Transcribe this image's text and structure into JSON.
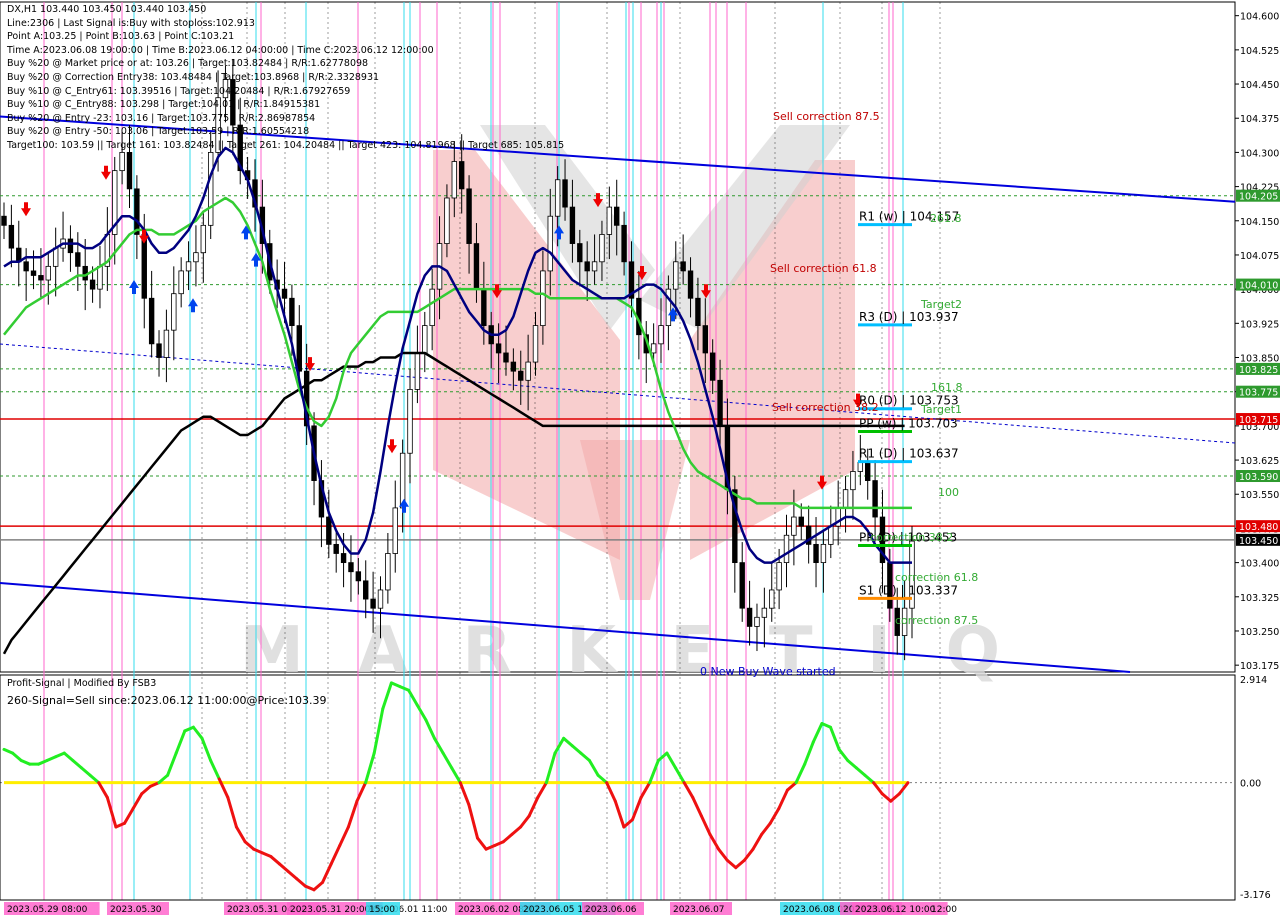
{
  "header": {
    "symbol_line": "DX,H1  103.440 103.450 103.440 103.450",
    "lines": [
      "Line:2306 | Last Signal is:Buy with stoploss:102.913",
      "Point A:103.25 | Point B:103.63 | Point C:103.21",
      "Time A:2023.06.08 19:00:00 | Time B:2023.06.12 04:00:00 | Time C:2023.06.12 12:00:00",
      "Buy %20 @ Market price or at: 103.26 | Target:103.82484 | R/R:1.62778098",
      "Buy %20 @ Correction Entry38: 103.48484 | Target:103.8968 | R/R:2.3328931",
      "Buy %10 @ C_Entry61: 103.39516 | Target:104.20484 | R/R:1.67927659",
      "Buy %10 @ C_Entry88: 103.298 | Target:104.01 | R/R:1.84915381",
      "Buy %20 @ Entry -23: 103.16 | Target:103.775 | R/R:2.86987854",
      "Buy %20 @ Entry -50: 103.06 | Target:103.59 | R/R:1.60554218",
      "Target100: 103.59 || Target 161: 103.82484 || Target 261: 104.20484 || Target 423: 104.81968 || Target 685: 105.815"
    ]
  },
  "indicator": {
    "title": "Profit-Signal | Modified By FSB3",
    "signal": "260-Signal=Sell since:2023.06.12 11:00:00@Price:103.39",
    "scale": [
      "2.914",
      "0.00",
      "-3.176"
    ]
  },
  "levels": [
    {
      "label": "R1 (w) | 104.157",
      "price": 104.157,
      "color": "#00bfff"
    },
    {
      "label": "R3 (D) | 103.937",
      "price": 103.937,
      "color": "#00bfff"
    },
    {
      "label": "R0 (D) | 103.753",
      "price": 103.753,
      "color": "#00bfff"
    },
    {
      "label": "PP (w) | 103.703",
      "price": 103.703,
      "color": "#00c000"
    },
    {
      "label": "R1 (D) | 103.637",
      "price": 103.637,
      "color": "#00bfff"
    },
    {
      "label": "PP (D) | 103.453",
      "price": 103.453,
      "color": "#00c000"
    },
    {
      "label": "S1 (D) | 103.337",
      "price": 103.337,
      "color": "#ff8c00"
    }
  ],
  "annotations": [
    {
      "text": "Sell correction 87.5",
      "color": "#c00000"
    },
    {
      "text": "Sell correction 61.8",
      "color": "#c00000"
    },
    {
      "text": "Sell correction 38.2",
      "color": "#c00000"
    },
    {
      "text": "261.8",
      "color": "#33aa33"
    },
    {
      "text": "Target2",
      "color": "#33aa33"
    },
    {
      "text": "161.8",
      "color": "#33aa33"
    },
    {
      "text": "Target1",
      "color": "#33aa33"
    },
    {
      "text": "100",
      "color": "#33aa33"
    },
    {
      "text": "correction 38.2",
      "color": "#33aa33"
    },
    {
      "text": "correction 61.8",
      "color": "#33aa33"
    },
    {
      "text": "correction 87.5",
      "color": "#33aa33"
    },
    {
      "text": "0 New Buy Wave started",
      "color": "#0000cc"
    }
  ],
  "time_labels": [
    "2023.05.29 08:00",
    "2023.05.30",
    "2023.05.31 04:00",
    "2023.05.31 20:00",
    "2023.06.01 11:00",
    "15:00",
    "2023.06.02 08:00",
    "2023.06.05 15:00",
    "2023.06.06",
    "2023.06.07",
    "2023.06.08 08:00",
    "2023.06.09",
    "2023.06.12 10:00",
    "12:00"
  ],
  "watermark": "MARKETIQ",
  "chart_data": {
    "type": "line",
    "price_axis": {
      "ticks": [
        "104.600",
        "104.525",
        "104.450",
        "104.375",
        "104.300",
        "104.225",
        "104.150",
        "104.075",
        "104.000",
        "103.925",
        "103.850",
        "103.775",
        "103.700",
        "103.625",
        "103.550",
        "103.475",
        "103.400",
        "103.325",
        "103.250",
        "103.175"
      ],
      "ylim": [
        103.16,
        104.63
      ]
    },
    "price_tags": [
      {
        "text": "104.205",
        "value": 104.205,
        "color": "#2e9a2e"
      },
      {
        "text": "104.010",
        "value": 104.01,
        "color": "#2e9a2e"
      },
      {
        "text": "103.825",
        "value": 103.825,
        "color": "#2e9a2e"
      },
      {
        "text": "103.775",
        "value": 103.775,
        "color": "#2e9a2e"
      },
      {
        "text": "103.715",
        "value": 103.715,
        "color": "#e00000"
      },
      {
        "text": "103.590",
        "value": 103.59,
        "color": "#2e9a2e"
      },
      {
        "text": "103.480",
        "value": 103.48,
        "color": "#e00000"
      },
      {
        "text": "103.450",
        "value": 103.45,
        "color": "#000000"
      }
    ],
    "horizontal_lines": [
      {
        "value": 104.205,
        "style": "dashed",
        "color": "#2e9a2e"
      },
      {
        "value": 104.01,
        "style": "dashed",
        "color": "#2e9a2e"
      },
      {
        "value": 103.825,
        "style": "dashed",
        "color": "#2e9a2e"
      },
      {
        "value": 103.775,
        "style": "dashed",
        "color": "#2e9a2e"
      },
      {
        "value": 103.715,
        "style": "solid",
        "color": "#e00000"
      },
      {
        "value": 103.59,
        "style": "dashed",
        "color": "#2e9a2e"
      },
      {
        "value": 103.48,
        "style": "solid",
        "color": "#e00000"
      },
      {
        "value": 103.45,
        "style": "solid",
        "color": "#808080"
      }
    ],
    "close": [
      104.14,
      104.09,
      104.06,
      104.04,
      104.03,
      104.02,
      104.05,
      104.09,
      104.11,
      104.08,
      104.05,
      104.02,
      104.0,
      104.05,
      104.12,
      104.26,
      104.3,
      104.22,
      104.12,
      103.98,
      103.88,
      103.85,
      103.91,
      103.99,
      104.04,
      104.06,
      104.08,
      104.14,
      104.3,
      104.42,
      104.46,
      104.36,
      104.26,
      104.24,
      104.18,
      104.1,
      104.02,
      104.0,
      103.98,
      103.92,
      103.82,
      103.7,
      103.58,
      103.5,
      103.44,
      103.42,
      103.4,
      103.38,
      103.36,
      103.32,
      103.3,
      103.34,
      103.42,
      103.52,
      103.64,
      103.78,
      103.86,
      103.92,
      104.0,
      104.1,
      104.2,
      104.28,
      104.22,
      104.1,
      104.0,
      103.92,
      103.88,
      103.86,
      103.84,
      103.82,
      103.8,
      103.84,
      103.92,
      104.04,
      104.16,
      104.24,
      104.18,
      104.1,
      104.06,
      104.04,
      104.06,
      104.12,
      104.18,
      104.14,
      104.06,
      103.98,
      103.9,
      103.86,
      103.88,
      103.92,
      104.0,
      104.06,
      104.04,
      103.98,
      103.92,
      103.86,
      103.8,
      103.7,
      103.56,
      103.4,
      103.3,
      103.26,
      103.28,
      103.3,
      103.34,
      103.4,
      103.46,
      103.5,
      103.48,
      103.44,
      103.4,
      103.44,
      103.48,
      103.52,
      103.56,
      103.6,
      103.62,
      103.58,
      103.5,
      103.4,
      103.3,
      103.24,
      103.3,
      103.45
    ],
    "sma_blue": [
      104.05,
      104.06,
      104.06,
      104.07,
      104.07,
      104.07,
      104.08,
      104.09,
      104.1,
      104.1,
      104.1,
      104.09,
      104.09,
      104.1,
      104.12,
      104.14,
      104.16,
      104.16,
      104.15,
      104.13,
      104.1,
      104.08,
      104.08,
      104.09,
      104.11,
      104.13,
      104.16,
      104.2,
      104.25,
      104.29,
      104.31,
      104.3,
      104.27,
      104.24,
      104.19,
      104.13,
      104.06,
      104.0,
      103.94,
      103.88,
      103.8,
      103.72,
      103.64,
      103.57,
      103.51,
      103.47,
      103.44,
      103.42,
      103.42,
      103.45,
      103.51,
      103.6,
      103.7,
      103.79,
      103.87,
      103.93,
      103.99,
      104.03,
      104.05,
      104.05,
      104.04,
      104.01,
      103.98,
      103.95,
      103.93,
      103.91,
      103.9,
      103.9,
      103.91,
      103.94,
      103.99,
      104.04,
      104.08,
      104.09,
      104.08,
      104.06,
      104.04,
      104.02,
      104.01,
      104.0,
      103.99,
      103.98,
      103.98,
      103.98,
      103.98,
      103.99,
      104.0,
      104.01,
      104.01,
      104.0,
      103.98,
      103.96,
      103.93,
      103.89,
      103.84,
      103.78,
      103.72,
      103.65,
      103.58,
      103.52,
      103.47,
      103.43,
      103.41,
      103.4,
      103.4,
      103.41,
      103.42,
      103.43,
      103.44,
      103.45,
      103.46,
      103.47,
      103.48,
      103.49,
      103.5,
      103.5,
      103.49,
      103.47,
      103.44,
      103.42,
      103.4,
      103.4,
      103.4,
      103.4
    ],
    "sma_green": [
      103.9,
      103.92,
      103.94,
      103.96,
      103.97,
      103.98,
      103.99,
      104.0,
      104.01,
      104.02,
      104.03,
      104.03,
      104.04,
      104.05,
      104.06,
      104.08,
      104.1,
      104.12,
      104.13,
      104.13,
      104.13,
      104.12,
      104.12,
      104.12,
      104.13,
      104.14,
      104.15,
      104.17,
      104.18,
      104.19,
      104.2,
      104.19,
      104.17,
      104.14,
      104.1,
      104.06,
      104.0,
      103.95,
      103.9,
      103.84,
      103.78,
      103.74,
      103.71,
      103.7,
      103.72,
      103.76,
      103.82,
      103.86,
      103.88,
      103.9,
      103.92,
      103.94,
      103.95,
      103.95,
      103.95,
      103.95,
      103.95,
      103.96,
      103.97,
      103.98,
      103.99,
      104.0,
      104.0,
      104.0,
      104.0,
      104.0,
      104.0,
      104.0,
      104.0,
      104.0,
      104.0,
      104.0,
      103.99,
      103.99,
      103.98,
      103.98,
      103.98,
      103.98,
      103.98,
      103.98,
      103.98,
      103.98,
      103.98,
      103.98,
      103.97,
      103.96,
      103.93,
      103.89,
      103.84,
      103.78,
      103.73,
      103.69,
      103.65,
      103.62,
      103.6,
      103.59,
      103.58,
      103.57,
      103.56,
      103.55,
      103.54,
      103.54,
      103.53,
      103.53,
      103.53,
      103.53,
      103.53,
      103.53,
      103.52,
      103.52,
      103.52,
      103.52,
      103.52,
      103.52,
      103.52,
      103.52,
      103.52,
      103.52,
      103.52,
      103.52,
      103.52,
      103.52,
      103.52,
      103.52
    ],
    "sma_black": [
      103.2,
      103.23,
      103.25,
      103.27,
      103.29,
      103.31,
      103.33,
      103.35,
      103.37,
      103.39,
      103.41,
      103.43,
      103.45,
      103.47,
      103.49,
      103.51,
      103.53,
      103.55,
      103.57,
      103.59,
      103.61,
      103.63,
      103.65,
      103.67,
      103.69,
      103.7,
      103.71,
      103.72,
      103.72,
      103.71,
      103.7,
      103.69,
      103.68,
      103.68,
      103.69,
      103.7,
      103.72,
      103.74,
      103.76,
      103.77,
      103.78,
      103.79,
      103.8,
      103.8,
      103.81,
      103.82,
      103.83,
      103.83,
      103.83,
      103.84,
      103.84,
      103.85,
      103.85,
      103.85,
      103.86,
      103.86,
      103.86,
      103.86,
      103.85,
      103.84,
      103.83,
      103.82,
      103.81,
      103.8,
      103.79,
      103.78,
      103.77,
      103.76,
      103.75,
      103.74,
      103.73,
      103.72,
      103.71,
      103.7,
      103.7,
      103.7,
      103.7,
      103.7,
      103.7,
      103.7,
      103.7,
      103.7,
      103.7,
      103.7,
      103.7,
      103.7,
      103.7,
      103.7,
      103.7,
      103.7,
      103.7,
      103.7,
      103.7,
      103.7,
      103.7,
      103.7,
      103.7,
      103.7,
      103.7,
      103.7,
      103.7,
      103.7,
      103.7,
      103.7,
      103.7,
      103.7,
      103.7,
      103.7,
      103.7,
      103.7,
      103.7,
      103.7,
      103.7,
      103.7,
      103.7,
      103.7,
      103.7,
      103.7,
      103.7,
      103.7,
      103.7,
      103.7,
      103.7
    ],
    "oscillator": [
      0.9,
      0.8,
      0.6,
      0.5,
      0.5,
      0.6,
      0.7,
      0.8,
      0.6,
      0.4,
      0.2,
      0.0,
      -0.4,
      -1.2,
      -1.1,
      -0.7,
      -0.3,
      -0.1,
      0.0,
      0.2,
      0.8,
      1.4,
      1.5,
      1.2,
      0.6,
      0.1,
      -0.4,
      -1.2,
      -1.6,
      -1.8,
      -1.9,
      -2.0,
      -2.2,
      -2.4,
      -2.6,
      -2.8,
      -2.9,
      -2.7,
      -2.2,
      -1.7,
      -1.2,
      -0.5,
      0.0,
      0.8,
      2.0,
      2.7,
      2.6,
      2.5,
      2.1,
      1.7,
      1.2,
      0.8,
      0.4,
      0.0,
      -0.6,
      -1.5,
      -1.8,
      -1.7,
      -1.6,
      -1.4,
      -1.2,
      -0.9,
      -0.4,
      0.0,
      0.8,
      1.2,
      1.0,
      0.8,
      0.6,
      0.2,
      0.0,
      -0.5,
      -1.2,
      -1.0,
      -0.4,
      0.0,
      0.6,
      0.8,
      0.4,
      0.0,
      -0.4,
      -0.9,
      -1.4,
      -1.8,
      -2.1,
      -2.3,
      -2.1,
      -1.8,
      -1.4,
      -1.1,
      -0.7,
      -0.2,
      0.0,
      0.5,
      1.1,
      1.6,
      1.5,
      0.9,
      0.6,
      0.4,
      0.2,
      0.0,
      -0.3,
      -0.5,
      -0.3,
      0.0
    ]
  }
}
